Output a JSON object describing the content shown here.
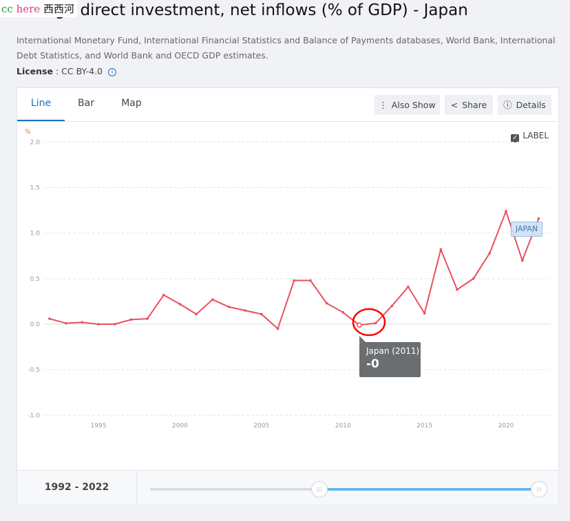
{
  "watermark": {
    "part1": "cc",
    "part2": "here",
    "part3": "西西河"
  },
  "title": "Foreign direct investment, net inflows (% of GDP) - Japan",
  "source": "International Monetary Fund, International Financial Statistics and Balance of Payments databases, World Bank, International Debt Statistics, and World Bank and OECD GDP estimates.",
  "license": {
    "label": "License",
    "value": ": CC BY-4.0"
  },
  "tabs": [
    {
      "label": "Line",
      "active": true
    },
    {
      "label": "Bar"
    },
    {
      "label": "Map"
    }
  ],
  "buttons": {
    "also_show": "Also Show",
    "share": "Share",
    "details": "Details"
  },
  "label_toggle": {
    "label": "LABEL",
    "checked": true
  },
  "tooltip": {
    "title": "Japan (2011)",
    "value": "-0"
  },
  "series_label": "JAPAN",
  "range": {
    "start": "1992",
    "sep": " - ",
    "end": "2022"
  },
  "colors": {
    "line": "#e8505b",
    "accent": "#1d6fc4",
    "slider": "#69b8ee",
    "highlight": "#ff0000"
  },
  "chart_data": {
    "type": "line",
    "ylabel": "%",
    "ylim": [
      -1.0,
      2.0
    ],
    "xlim": [
      1992,
      2022
    ],
    "yticks": [
      "2.0",
      "1.5",
      "1.0",
      "0.5",
      "0.0",
      "-0.5",
      "-1.0"
    ],
    "xticks": [
      "1995",
      "2000",
      "2005",
      "2010",
      "2015",
      "2020"
    ],
    "grid": true,
    "series": [
      {
        "name": "JAPAN",
        "x": [
          1992,
          1993,
          1994,
          1995,
          1996,
          1997,
          1998,
          1999,
          2000,
          2001,
          2002,
          2003,
          2004,
          2005,
          2006,
          2007,
          2008,
          2009,
          2010,
          2011,
          2012,
          2013,
          2014,
          2015,
          2016,
          2017,
          2018,
          2019,
          2020,
          2021,
          2022
        ],
        "values": [
          0.06,
          0.01,
          0.02,
          0.0,
          0.0,
          0.05,
          0.06,
          0.32,
          0.22,
          0.11,
          0.27,
          0.19,
          0.15,
          0.11,
          -0.05,
          0.48,
          0.48,
          0.23,
          0.13,
          -0.01,
          0.01,
          0.2,
          0.41,
          0.12,
          0.82,
          0.38,
          0.5,
          0.78,
          1.24,
          0.7,
          1.16
        ]
      }
    ],
    "highlighted_point": {
      "x": 2011
    }
  }
}
